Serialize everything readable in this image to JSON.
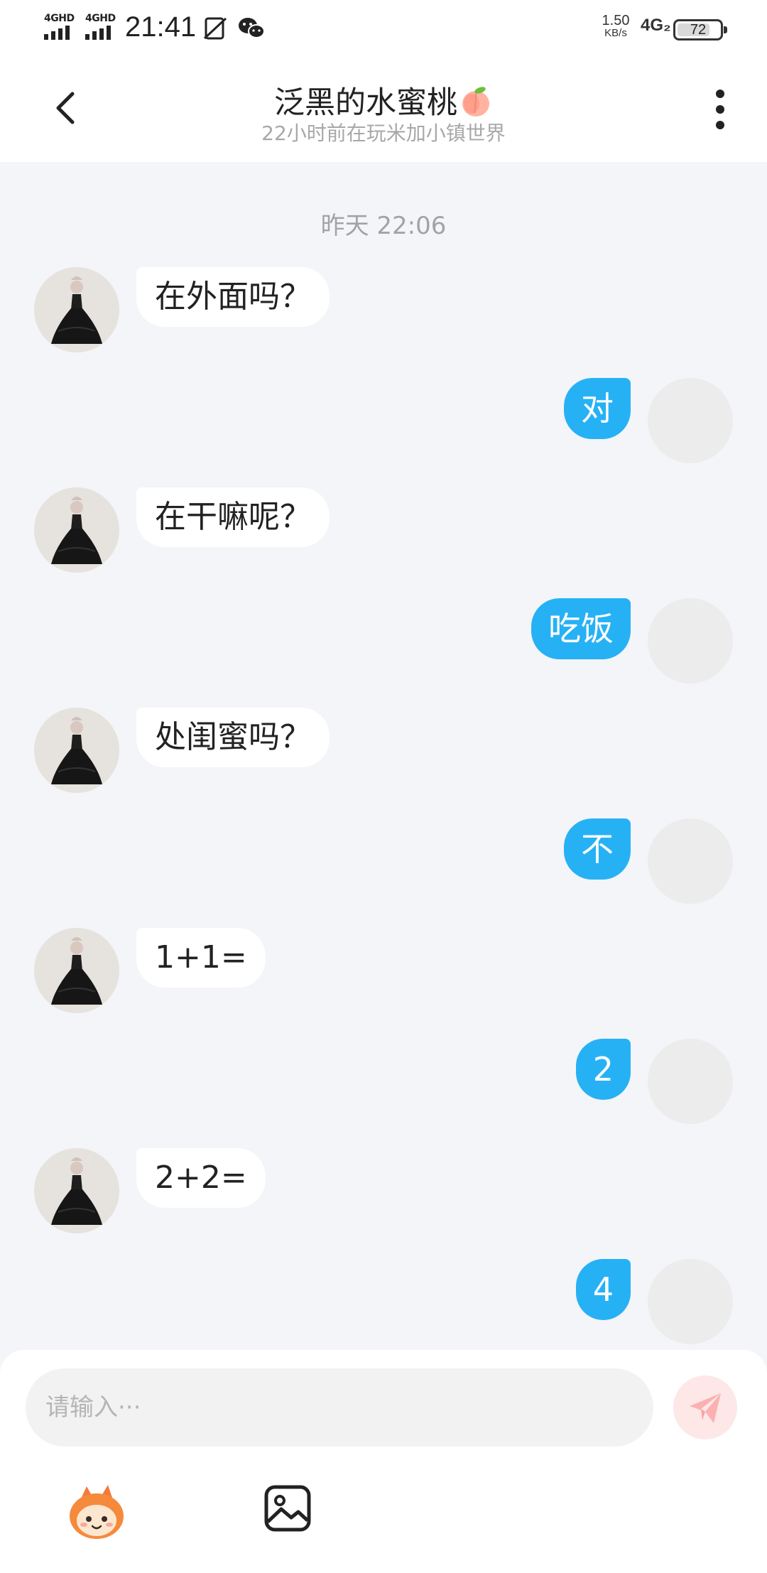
{
  "status_bar": {
    "sim1_label": "4GHD",
    "sim2_label": "4GHD",
    "time": "21:41",
    "net_speed_value": "1.50",
    "net_speed_unit": "KB/s",
    "network_type": "4G₂",
    "battery": "72"
  },
  "header": {
    "title": "泛黑的水蜜桃",
    "status": "22小时前在玩米加小镇世界"
  },
  "chat": {
    "timestamp": "昨天 22:06",
    "messages": [
      {
        "from": "other",
        "text": "在外面吗？"
      },
      {
        "from": "self",
        "text": "对"
      },
      {
        "from": "other",
        "text": "在干嘛呢？"
      },
      {
        "from": "self",
        "text": "吃饭"
      },
      {
        "from": "other",
        "text": "处闺蜜吗？"
      },
      {
        "from": "self",
        "text": "不"
      },
      {
        "from": "other",
        "text": "1+1="
      },
      {
        "from": "self",
        "text": "2"
      },
      {
        "from": "other",
        "text": "2+2="
      },
      {
        "from": "self",
        "text": "4"
      }
    ]
  },
  "input_bar": {
    "placeholder": "请输入···",
    "value": ""
  },
  "icons": {
    "back": "chevron-left-icon",
    "more": "more-vertical-icon",
    "send": "paper-plane-icon",
    "emoji": "mascot-emoji-icon",
    "image": "image-icon"
  },
  "colors": {
    "self_bubble": "#27b1f5",
    "send_button": "#f47a7a",
    "chat_background": "#f3f5f8"
  }
}
